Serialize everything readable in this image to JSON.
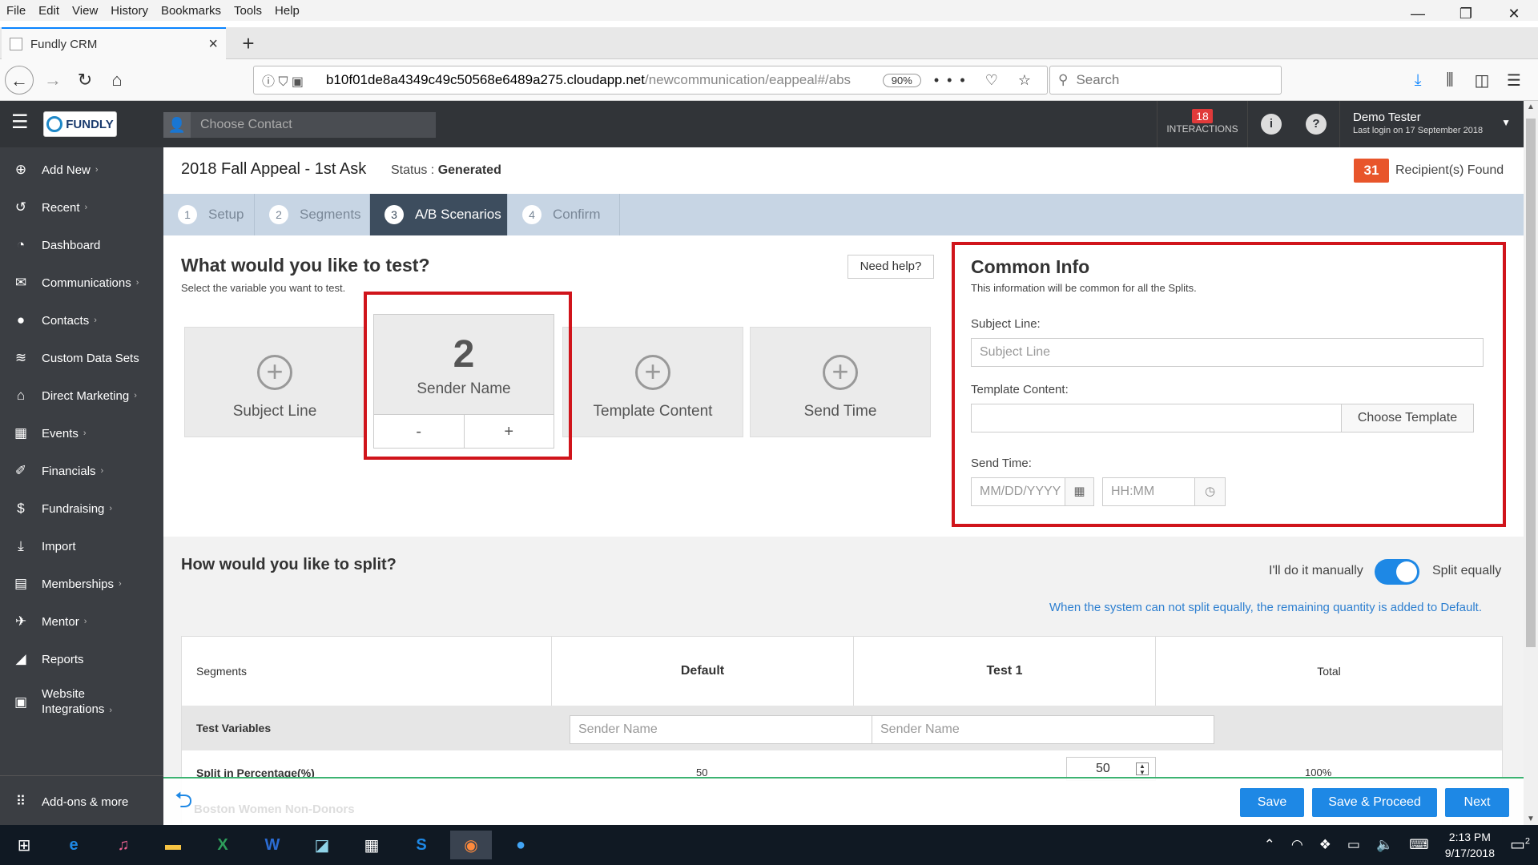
{
  "browser": {
    "menu": [
      "File",
      "Edit",
      "View",
      "History",
      "Bookmarks",
      "Tools",
      "Help"
    ],
    "tab_title": "Fundly CRM",
    "url_main": "b10f01de8a4349c49c50568e6489a275.cloudapp.net",
    "url_path": "/newcommunication/eappeal#/abs",
    "zoom": "90%",
    "search_placeholder": "Search"
  },
  "app": {
    "logo_text": "FUNDLY",
    "contact_placeholder": "Choose Contact",
    "interactions_count": "18",
    "interactions_label": "INTERACTIONS",
    "user_name": "Demo Tester",
    "last_login": "Last login on 17 September 2018"
  },
  "sidebar": {
    "items": [
      {
        "label": "Add New",
        "chev": "›"
      },
      {
        "label": "Recent",
        "chev": "›"
      },
      {
        "label": "Dashboard",
        "chev": ""
      },
      {
        "label": "Communications",
        "chev": "›"
      },
      {
        "label": "Contacts",
        "chev": "›"
      },
      {
        "label": "Custom Data Sets",
        "chev": ""
      },
      {
        "label": "Direct Marketing",
        "chev": "›"
      },
      {
        "label": "Events",
        "chev": "›"
      },
      {
        "label": "Financials",
        "chev": "›"
      },
      {
        "label": "Fundraising",
        "chev": "›"
      },
      {
        "label": "Import",
        "chev": ""
      },
      {
        "label": "Memberships",
        "chev": "›"
      },
      {
        "label": "Mentor",
        "chev": "›"
      },
      {
        "label": "Reports",
        "chev": ""
      },
      {
        "label": "Website",
        "label2": "Integrations",
        "chev": "›"
      }
    ],
    "addons": "Add-ons & more"
  },
  "page": {
    "campaign": "2018 Fall Appeal - 1st Ask",
    "status_label": "Status :",
    "status_value": "Generated",
    "recipients_count": "31",
    "recipients_label": "Recipient(s) Found",
    "steps": [
      {
        "n": "1",
        "label": "Setup"
      },
      {
        "n": "2",
        "label": "Segments"
      },
      {
        "n": "3",
        "label": "A/B Scenarios"
      },
      {
        "n": "4",
        "label": "Confirm"
      }
    ]
  },
  "test_section": {
    "title": "What would you like to test?",
    "subtitle": "Select the variable you want to test.",
    "need_help": "Need help?",
    "cards": {
      "subject": "Subject Line",
      "sender_count": "2",
      "sender": "Sender Name",
      "template": "Template Content",
      "sendtime": "Send Time"
    },
    "minus": "-",
    "plus": "+"
  },
  "common_info": {
    "title": "Common Info",
    "subtitle": "This information will be common for all the Splits.",
    "subject_label": "Subject Line:",
    "subject_placeholder": "Subject Line",
    "template_label": "Template Content:",
    "choose_template": "Choose Template",
    "sendtime_label": "Send Time:",
    "date_placeholder": "MM/DD/YYYY",
    "time_placeholder": "HH:MM"
  },
  "split_section": {
    "title": "How would you like to split?",
    "manual": "I'll do it manually",
    "equal": "Split equally",
    "note": "When the system can not split equally, the remaining quantity is added to Default.",
    "headers": [
      "Segments",
      "Default",
      "Test 1",
      "Total"
    ],
    "test_variables": "Test Variables",
    "default_sender": "Sender Name",
    "test_sender": "Sender Name",
    "split_pct_label": "Split in Percentage(%)",
    "default_pct": "50",
    "test_pct": "50",
    "total_pct": "100%",
    "ghost_segment": "Boston Women Non-Donors"
  },
  "footer": {
    "save": "Save",
    "save_proceed": "Save & Proceed",
    "next": "Next"
  },
  "taskbar": {
    "time": "2:13 PM",
    "date": "9/17/2018",
    "notifications": "2"
  }
}
